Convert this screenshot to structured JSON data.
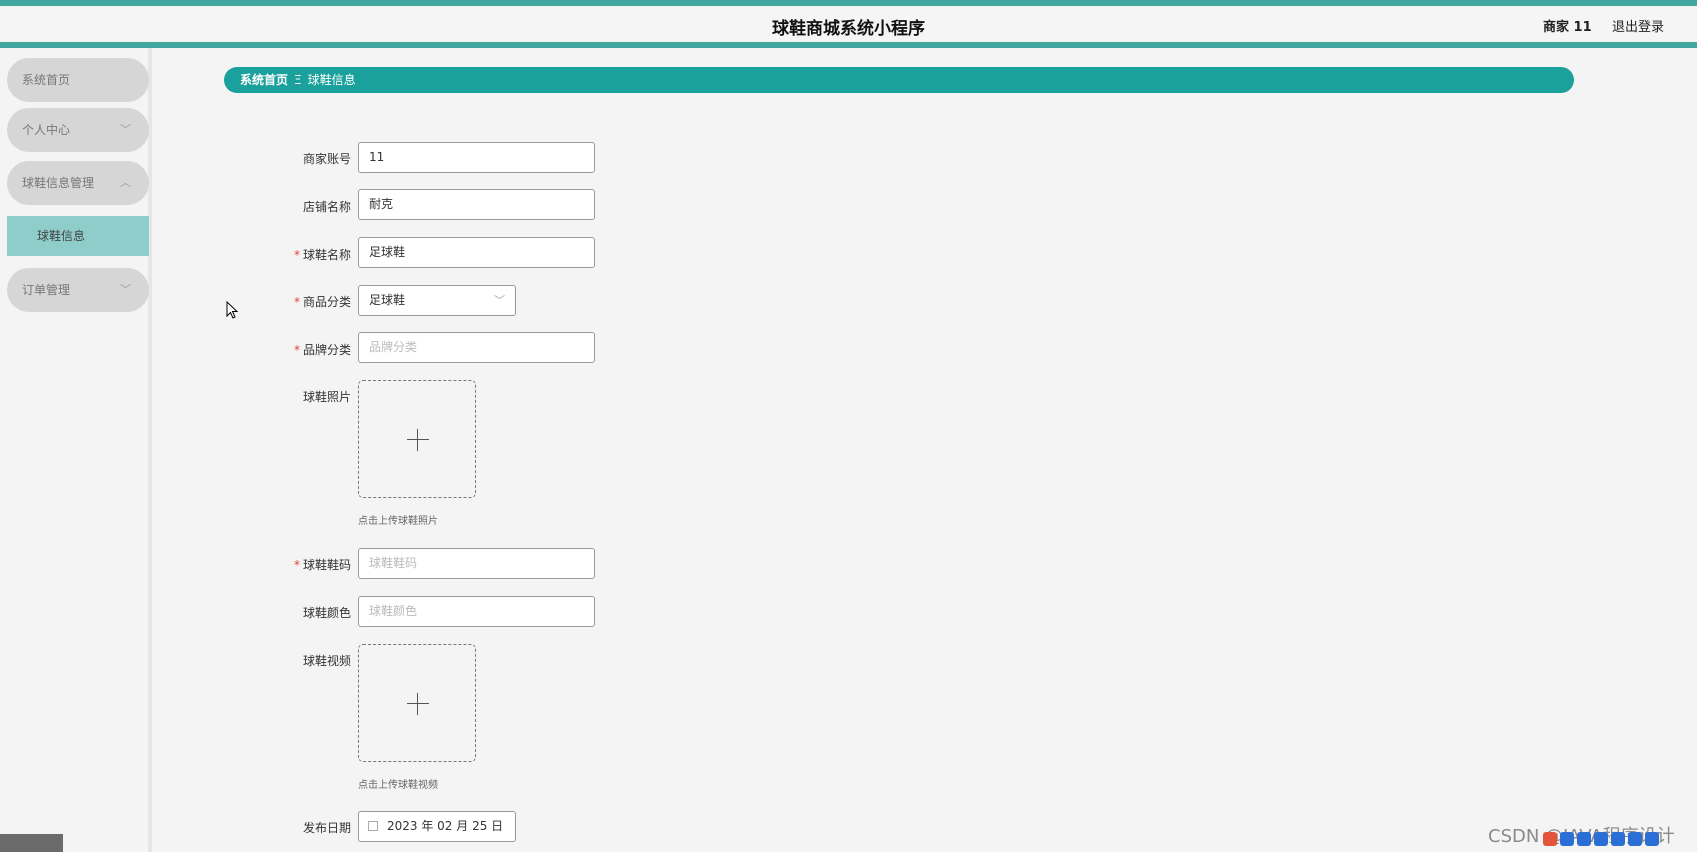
{
  "header": {
    "title": "球鞋商城系统小程序",
    "user": "商家 11",
    "logout": "退出登录"
  },
  "sidebar": {
    "items": [
      {
        "label": "系统首页",
        "chevron": ""
      },
      {
        "label": "个人中心",
        "chevron": "﹀"
      },
      {
        "label": "球鞋信息管理",
        "chevron": "︿"
      },
      {
        "label": "订单管理",
        "chevron": "﹀"
      }
    ],
    "submenu": {
      "label": "球鞋信息"
    }
  },
  "breadcrumb": {
    "home": "系统首页",
    "separator": "Ξ",
    "current": "球鞋信息"
  },
  "form": {
    "merchant_account": {
      "label": "商家账号",
      "value": "11"
    },
    "shop_name": {
      "label": "店铺名称",
      "value": "耐克"
    },
    "shoe_name": {
      "label": "球鞋名称",
      "value": "足球鞋",
      "required": true
    },
    "category": {
      "label": "商品分类",
      "value": "足球鞋",
      "required": true
    },
    "brand": {
      "label": "品牌分类",
      "placeholder": "品牌分类",
      "required": true
    },
    "photo": {
      "label": "球鞋照片",
      "hint": "点击上传球鞋照片"
    },
    "size": {
      "label": "球鞋鞋码",
      "placeholder": "球鞋鞋码",
      "required": true
    },
    "color": {
      "label": "球鞋颜色",
      "placeholder": "球鞋颜色"
    },
    "video": {
      "label": "球鞋视频",
      "hint": "点击上传球鞋视频"
    },
    "publish_date": {
      "label": "发布日期",
      "value": "2023 年 02 月 25 日"
    }
  },
  "watermark": "CSDN @JAVA程序设计",
  "icons": {
    "chevron_down": "chevron-down-icon",
    "chevron_up": "chevron-up-icon",
    "plus": "plus-icon",
    "calendar": "calendar-icon",
    "cursor": "mouse-cursor-icon"
  },
  "colors": {
    "accent": "#1aa19c",
    "top_border": "#41a7a0",
    "submenu_active": "#8ecdca",
    "menu_bg": "#d6d6d6",
    "required": "#e0453c"
  }
}
